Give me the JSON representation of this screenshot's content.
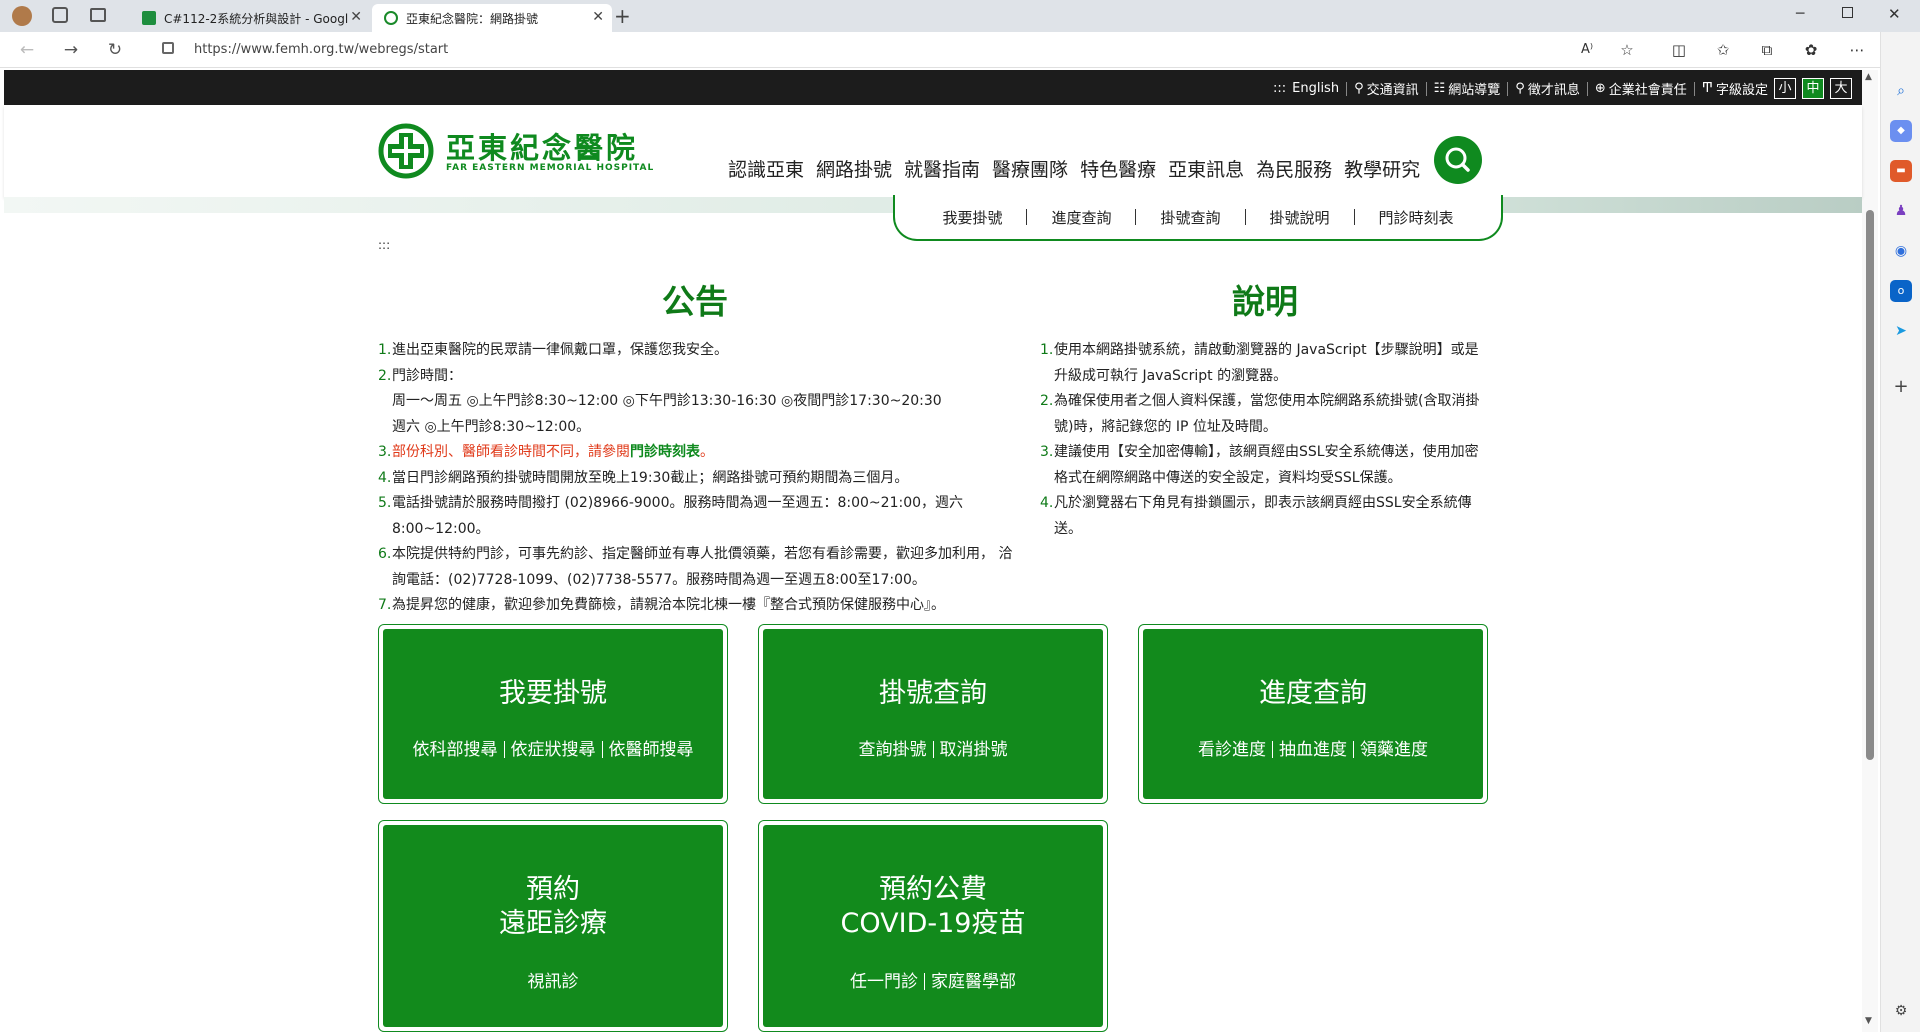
{
  "browser": {
    "tabs": [
      {
        "title": "C#112-2系統分析與設計 - Googl"
      },
      {
        "title": "亞東紀念醫院：網路掛號"
      }
    ],
    "url": "https://www.femh.org.tw/webregs/start"
  },
  "topbar": {
    "english": "English",
    "traffic": "交通資訊",
    "sitemap": "網站導覽",
    "recruit": "徵才訊息",
    "csr": "企業社會責任",
    "fontsize_label": "字級設定",
    "font_small": "小",
    "font_mid": "中",
    "font_large": "大"
  },
  "header": {
    "logo_cn": "亞東紀念醫院",
    "logo_en": "FAR EASTERN MEMORIAL HOSPITAL",
    "nav": [
      "認識亞東",
      "網路掛號",
      "就醫指南",
      "醫療團隊",
      "特色醫療",
      "亞東訊息",
      "為民服務",
      "教學研究"
    ]
  },
  "subnav": [
    "我要掛號",
    "進度查詢",
    "掛號查詢",
    "掛號說明",
    "門診時刻表"
  ],
  "triple_colon": ":::",
  "announcement": {
    "title": "公告",
    "items": [
      {
        "n": "1.",
        "text": "進出亞東醫院的民眾請一律佩戴口罩，保護您我安全。"
      },
      {
        "n": "2.",
        "text": "門診時間："
      },
      {
        "n": "",
        "text": "周一～周五 ◎上午門診8:30~12:00 ◎下午門診13:30-16:30 ◎夜間門診17:30~20:30"
      },
      {
        "n": "",
        "text": "週六 ◎上午門診8:30~12:00。"
      },
      {
        "n": "3.",
        "text_red": "部份科別、醫師看診時間不同，請參閱",
        "text_link": "門診時刻表",
        "text_end": "。"
      },
      {
        "n": "4.",
        "text": "當日門診網路預約掛號時間開放至晚上19:30截止；網路掛號可預約期間為三個月。"
      },
      {
        "n": "5.",
        "text": "電話掛號請於服務時間撥打 (02)8966-9000。服務時間為週一至週五：8:00~21:00，週六"
      },
      {
        "n": "",
        "text": "8:00~12:00。"
      },
      {
        "n": "6.",
        "text": "本院提供特約門診，可事先約診、指定醫師並有專人批價領藥，若您有看診需要，歡迎多加利用， 洽"
      },
      {
        "n": "",
        "text": "詢電話：(02)7728-1099、(02)7738-5577。服務時間為週一至週五8:00至17:00。"
      },
      {
        "n": "7.",
        "text": "為提昇您的健康，歡迎參加免費篩檢，請親洽本院北棟一樓『整合式預防保健服務中心』。"
      }
    ]
  },
  "explanation": {
    "title": "說明",
    "items": [
      {
        "n": "1.",
        "text": "使用本網路掛號系統，請啟動瀏覽器的 JavaScript【步驟說明】或是"
      },
      {
        "n": "",
        "text": "升級成可執行 JavaScript 的瀏覽器。"
      },
      {
        "n": "2.",
        "text": "為確保使用者之個人資料保護，當您使用本院網路系統掛號(含取消掛"
      },
      {
        "n": "",
        "text": "號)時，將記錄您的 IP 位址及時間。"
      },
      {
        "n": "3.",
        "text": "建議使用【安全加密傳輸】，該網頁經由SSL安全系統傳送，使用加密"
      },
      {
        "n": "",
        "text": "格式在網際網路中傳送的安全設定，資料均受SSL保護。"
      },
      {
        "n": "4.",
        "text": "凡於瀏覽器右下角見有掛鎖圖示，即表示該網頁經由SSL安全系統傳"
      },
      {
        "n": "",
        "text": "送。"
      }
    ]
  },
  "cards": [
    {
      "title": "我要掛號",
      "title2": "",
      "links": [
        "依科部搜尋",
        "依症狀搜尋",
        "依醫師搜尋"
      ]
    },
    {
      "title": "掛號查詢",
      "title2": "",
      "links": [
        "查詢掛號",
        "取消掛號"
      ]
    },
    {
      "title": "進度查詢",
      "title2": "",
      "links": [
        "看診進度",
        "抽血進度",
        "領藥進度"
      ]
    },
    {
      "title": "預約",
      "title2": "遠距診療",
      "links": [
        "視訊診"
      ]
    },
    {
      "title": "預約公費",
      "title2": "COVID-19疫苗",
      "links": [
        "任一門診",
        "家庭醫學部"
      ]
    }
  ],
  "colors": {
    "brand_green": "#0f8a1f",
    "alert_red": "#e03a1a"
  }
}
